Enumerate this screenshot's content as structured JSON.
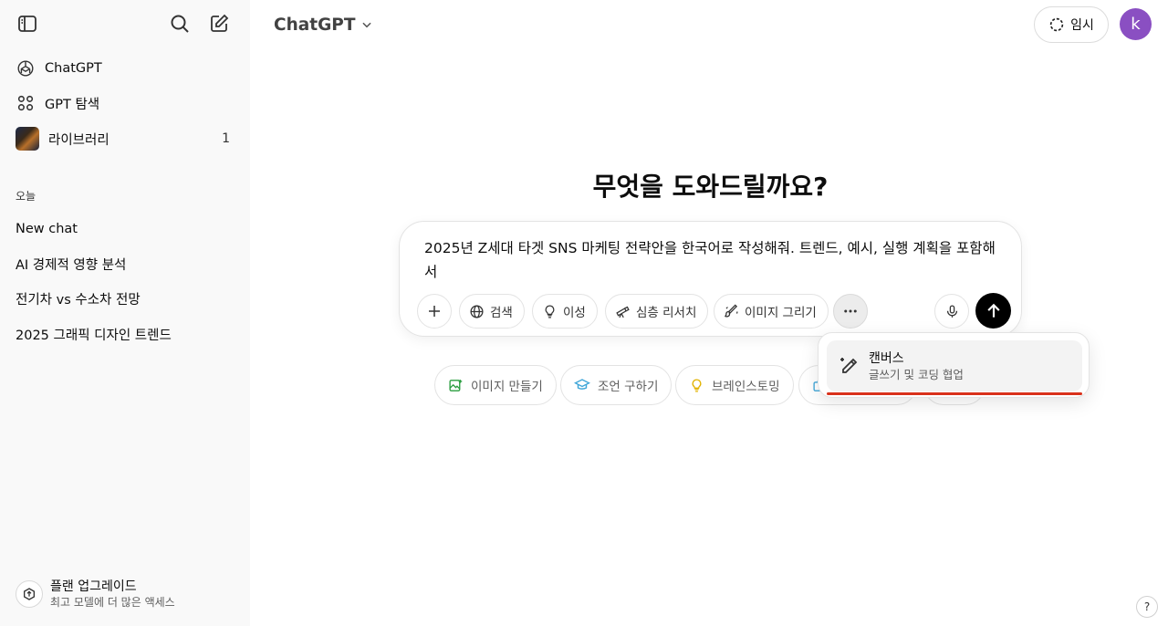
{
  "header": {
    "title": "ChatGPT",
    "temp_label": "임시",
    "avatar_letter": "k"
  },
  "sidebar": {
    "nav": [
      {
        "label": "ChatGPT"
      },
      {
        "label": "GPT 탐색"
      },
      {
        "label": "라이브러리",
        "count": "1"
      }
    ],
    "section_today": "오늘",
    "chats": [
      {
        "label": "New chat"
      },
      {
        "label": "AI 경제적 영향 분석"
      },
      {
        "label": "전기차 vs 수소차 전망"
      },
      {
        "label": "2025 그래픽 디자인 트렌드"
      }
    ],
    "upgrade": {
      "title": "플랜 업그레이드",
      "subtitle": "최고 모델에 더 많은 액세스"
    }
  },
  "main": {
    "headline": "무엇을 도와드릴까요?",
    "prompt": "2025년 Z세대 타겟 SNS 마케팅 전략안을 한국어로 작성해줘. 트렌드, 예시, 실행 계획을 포함해서",
    "tools": {
      "search": "검색",
      "reason": "이성",
      "deep_research": "심층 리서치",
      "draw_image": "이미지 그리기"
    },
    "chips": {
      "make_image": "이미지 만들기",
      "get_advice": "조언 구하기",
      "brainstorm": "브레인스토밍"
    }
  },
  "dropdown": {
    "title": "캔버스",
    "subtitle": "글쓰기 및 코딩 협업"
  },
  "help_label": "?",
  "colors": {
    "send": "#000000",
    "avatar": "#8a4fc2",
    "highlight_line": "#d9311b"
  }
}
